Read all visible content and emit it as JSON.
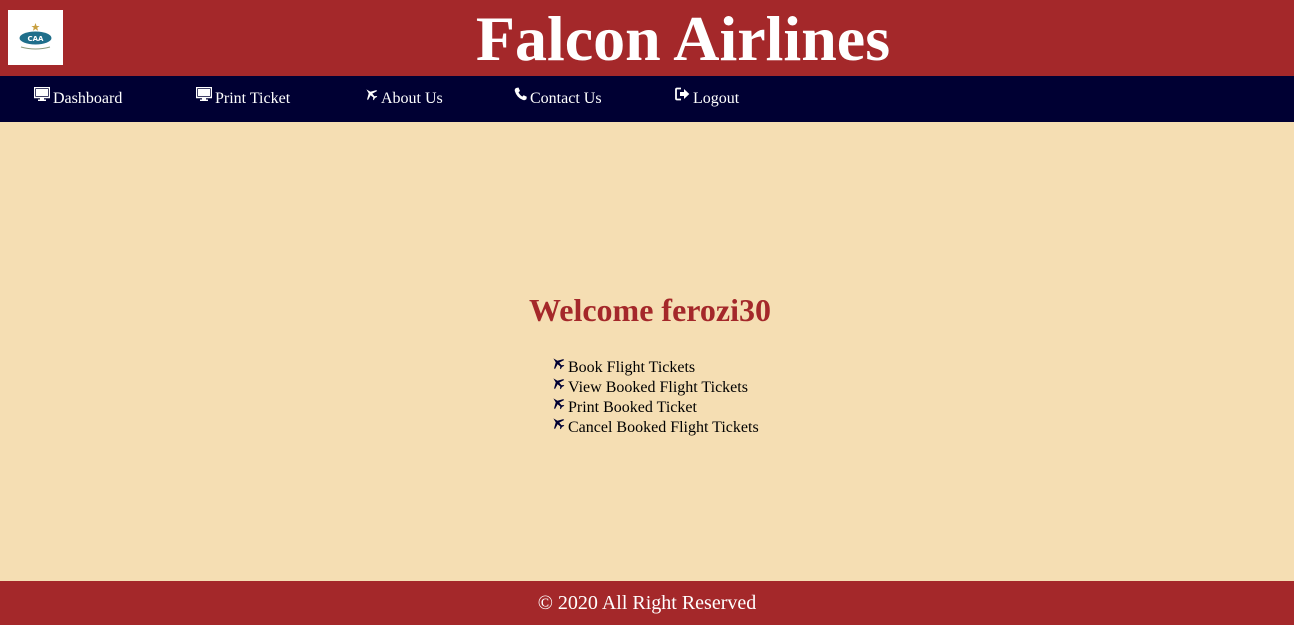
{
  "header": {
    "title": "Falcon Airlines",
    "logo_text": "CAA",
    "logo_icon": "caa-logo"
  },
  "nav": {
    "items": [
      {
        "label": "Dashboard",
        "icon": "desktop-icon"
      },
      {
        "label": "Print Ticket",
        "icon": "desktop-icon"
      },
      {
        "label": "About Us",
        "icon": "plane-icon"
      },
      {
        "label": "Contact Us",
        "icon": "phone-icon"
      },
      {
        "label": "Logout",
        "icon": "sign-out-icon"
      }
    ]
  },
  "main": {
    "welcome": "Welcome ferozi30",
    "links": [
      {
        "label": "Book Flight Tickets",
        "icon": "plane-icon"
      },
      {
        "label": "View Booked Flight Tickets",
        "icon": "plane-icon"
      },
      {
        "label": "Print Booked Ticket",
        "icon": "plane-icon"
      },
      {
        "label": "Cancel Booked Flight Tickets",
        "icon": "plane-icon"
      }
    ]
  },
  "footer": {
    "text": "© 2020 All Right Reserved"
  },
  "colors": {
    "header_bg": "#a4282a",
    "nav_bg": "#000033",
    "main_bg": "#f5deb3",
    "welcome_text": "#a4282a",
    "footer_bg": "#a4282a"
  }
}
